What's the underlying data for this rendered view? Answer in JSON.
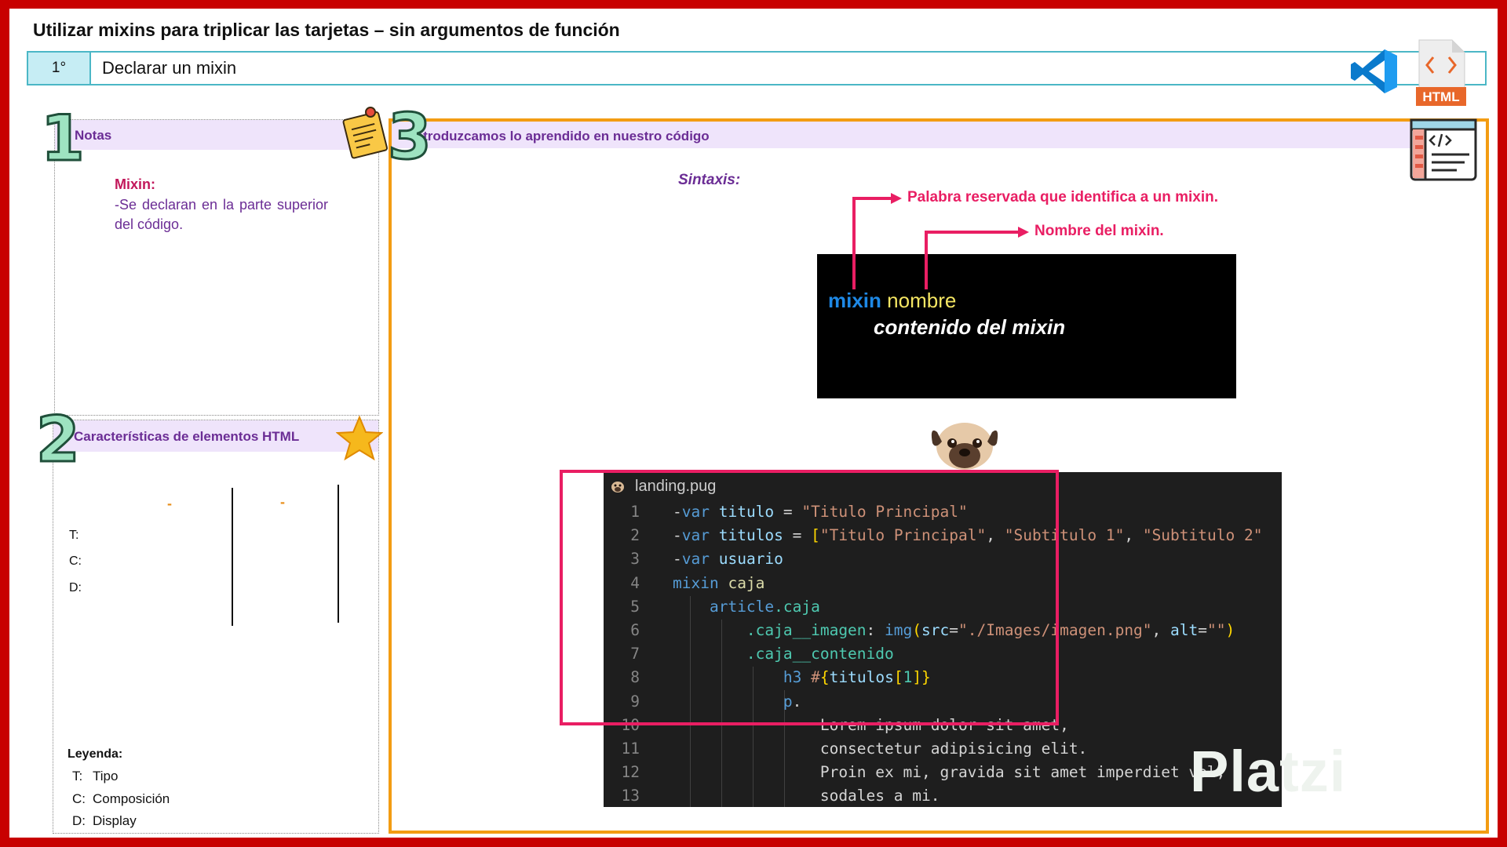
{
  "title": "Utilizar mixins para triplicar las tarjetas – sin argumentos de función",
  "step": {
    "number": "1°",
    "label": "Declarar un mixin"
  },
  "icons": {
    "vscode": "vscode-icon",
    "html_file": "html-file-icon",
    "html_badge": "HTML",
    "code_window": "code-window-icon"
  },
  "panel1": {
    "number": "1",
    "heading": "Notas",
    "note_label": "Mixin:",
    "note_text": "-Se declaran en la parte superior del código."
  },
  "panel2": {
    "number": "2",
    "heading": "Características de elementos HTML",
    "dashes": [
      "-",
      "-"
    ],
    "rows": [
      "T:",
      "C:",
      "D:"
    ],
    "legend_title": "Leyenda:",
    "legend": [
      {
        "key": "T:",
        "value": "Tipo"
      },
      {
        "key": "C:",
        "value": "Composición"
      },
      {
        "key": "D:",
        "value": "Display"
      }
    ]
  },
  "panel3": {
    "number": "3",
    "heading": "Introduzcamos lo aprendido en nuestro código",
    "sintaxis_label": "Sintaxis:",
    "annotation_keyword": "Palabra reservada que identifica a un mixin.",
    "annotation_name": "Nombre del mixin.",
    "syntax_keyword": "mixin",
    "syntax_name": "nombre",
    "syntax_content": "contenido del mixin"
  },
  "editor": {
    "filename": "landing.pug",
    "line_numbers": [
      "1",
      "2",
      "3",
      "4",
      "5",
      "6",
      "7",
      "8",
      "9",
      "10",
      "11",
      "12",
      "13"
    ]
  },
  "watermark": "Platzi",
  "colors": {
    "frame": "#c80000",
    "panel3_border": "#f39c12",
    "accent_pink": "#e91e63",
    "heading_purple": "#6b2d95",
    "step_border": "#4bb7c6"
  }
}
